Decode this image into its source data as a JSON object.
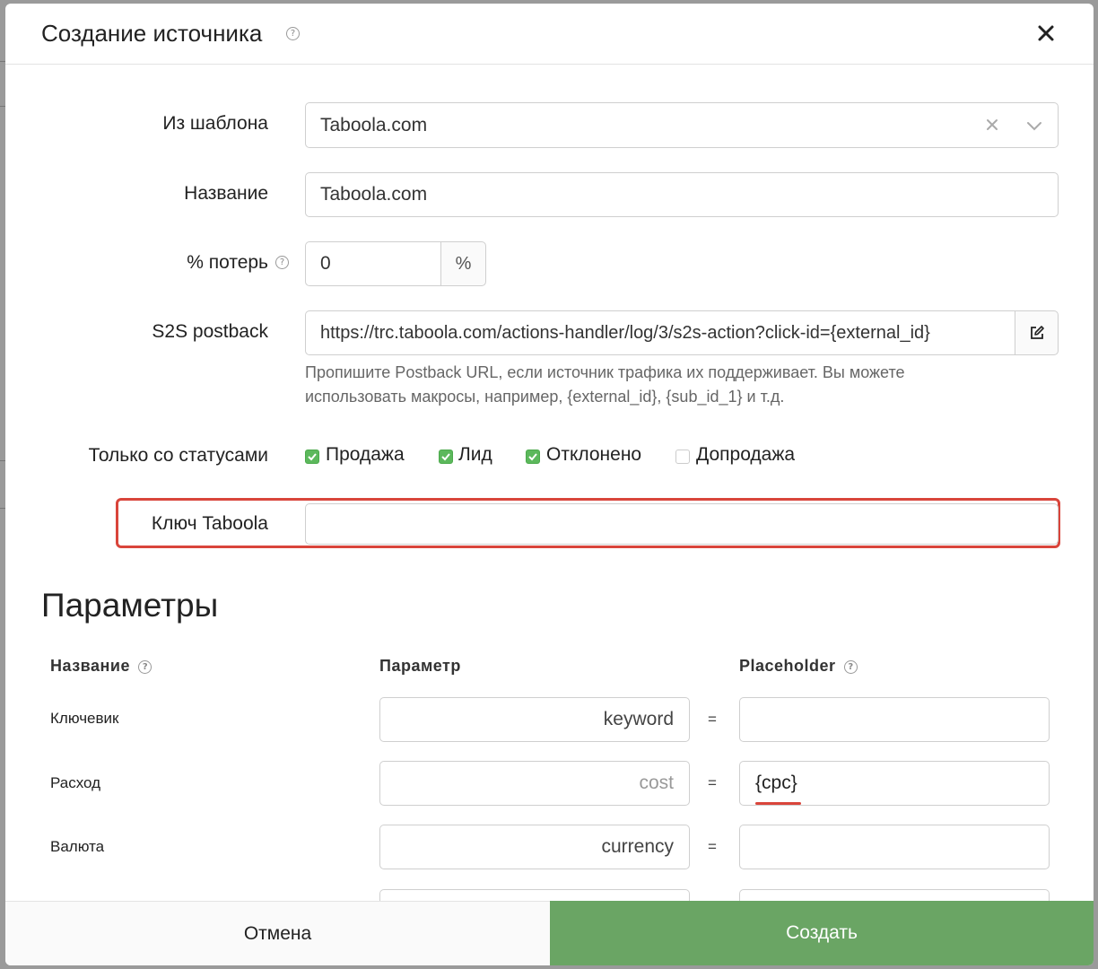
{
  "dialog": {
    "title": "Создание источника"
  },
  "form": {
    "template": {
      "label": "Из шаблона",
      "value": "Taboola.com"
    },
    "name": {
      "label": "Название",
      "value": "Taboola.com"
    },
    "loss": {
      "label": "% потерь",
      "value": "0",
      "suffix": "%"
    },
    "postback": {
      "label": "S2S postback",
      "value": "https://trc.taboola.com/actions-handler/log/3/s2s-action?click-id={external_id}",
      "hint_line1": "Пропишите Postback URL, если источник трафика их поддерживает. Вы можете",
      "hint_line2": "использовать макросы, например, {external_id}, {sub_id_1} и т.д."
    },
    "statuses": {
      "label": "Только со статусами",
      "options": [
        {
          "label": "Продажа",
          "checked": true
        },
        {
          "label": "Лид",
          "checked": true
        },
        {
          "label": "Отклонено",
          "checked": true
        },
        {
          "label": "Допродажа",
          "checked": false
        }
      ]
    },
    "taboola_key": {
      "label": "Ключ Taboola",
      "value": ""
    }
  },
  "parameters": {
    "title": "Параметры",
    "headers": {
      "name": "Название",
      "param": "Параметр",
      "placeholder": "Placeholder"
    },
    "rows": [
      {
        "name": "Ключевик",
        "param": "keyword",
        "param_is_placeholder": false,
        "placeholder": ""
      },
      {
        "name": "Расход",
        "param": "cost",
        "param_is_placeholder": true,
        "placeholder": "{cpc}"
      },
      {
        "name": "Валюта",
        "param": "currency",
        "param_is_placeholder": false,
        "placeholder": ""
      }
    ],
    "equals": "="
  },
  "footer": {
    "cancel_label": "Отмена",
    "create_label": "Создать"
  },
  "colors": {
    "accent_green": "#6aa564",
    "checkbox_green": "#5cb85c",
    "highlight_red": "#d9453b"
  }
}
